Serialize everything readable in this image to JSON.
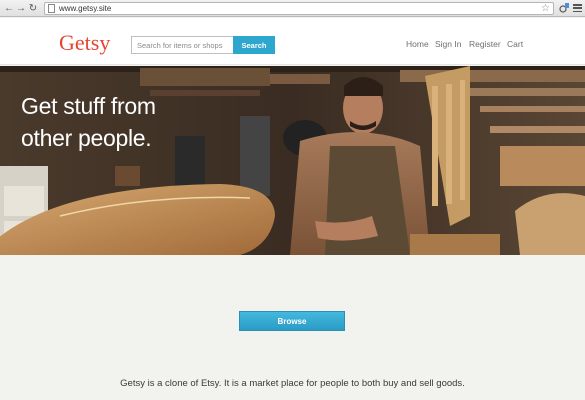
{
  "browser": {
    "url": "www.getsy.site",
    "icons": [
      "back-arrow-icon",
      "forward-arrow-icon",
      "reload-icon",
      "page-icon",
      "star-icon",
      "extension-icon",
      "menu-icon"
    ]
  },
  "header": {
    "logo": "Getsy",
    "search_placeholder": "Search for items or shops",
    "search_button": "Search",
    "nav": [
      "Home",
      "Sign In",
      "Register",
      "Cart"
    ],
    "brand_color": "#e5452f",
    "accent_color": "#2ea7cf"
  },
  "hero": {
    "headline_line1": "Get stuff from",
    "headline_line2": "other people."
  },
  "main": {
    "browse_button": "Browse",
    "description": "Getsy is a clone of Etsy. It is a market place for people to both buy and sell goods."
  }
}
